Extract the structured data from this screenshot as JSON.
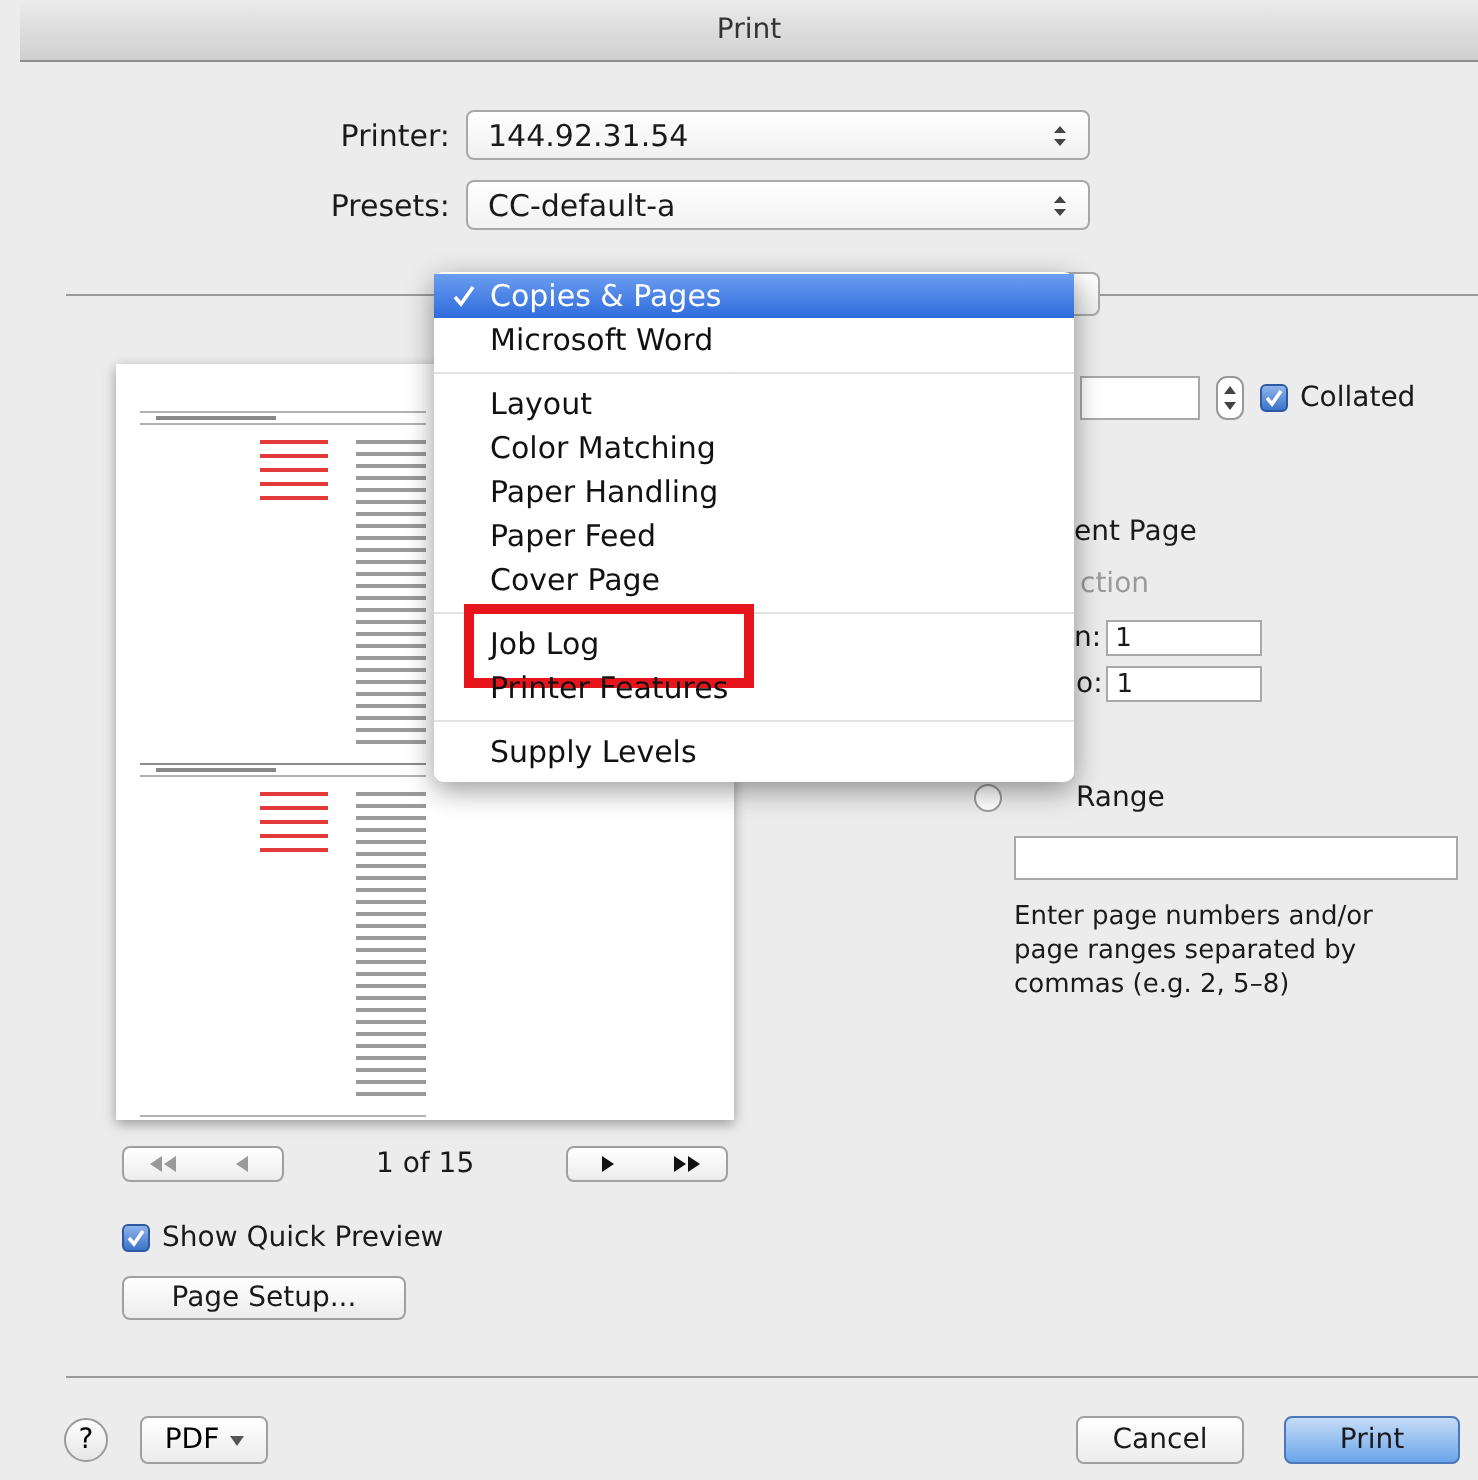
{
  "window": {
    "title": "Print"
  },
  "printer": {
    "label": "Printer:",
    "value": "144.92.31.54"
  },
  "presets": {
    "label": "Presets:",
    "value": "CC-default-a"
  },
  "panel_menu": {
    "groups": [
      [
        {
          "label": "Copies & Pages",
          "selected": true,
          "highlighted": false
        },
        {
          "label": "Microsoft Word",
          "selected": false,
          "highlighted": false
        }
      ],
      [
        {
          "label": "Layout",
          "selected": false,
          "highlighted": false
        },
        {
          "label": "Color Matching",
          "selected": false,
          "highlighted": false
        },
        {
          "label": "Paper Handling",
          "selected": false,
          "highlighted": false
        },
        {
          "label": "Paper Feed",
          "selected": false,
          "highlighted": false
        },
        {
          "label": "Cover Page",
          "selected": false,
          "highlighted": false
        }
      ],
      [
        {
          "label": "Job Log",
          "selected": false,
          "highlighted": true
        },
        {
          "label": "Printer Features",
          "selected": false,
          "highlighted": false
        }
      ],
      [
        {
          "label": "Supply Levels",
          "selected": false,
          "highlighted": false
        }
      ]
    ]
  },
  "copies": {
    "collated": {
      "label": "Collated",
      "checked": true
    }
  },
  "pages": {
    "current_page_label": "ent Page",
    "selection_label": "ction",
    "selection_disabled": true,
    "from": {
      "label": "n:",
      "value": "1"
    },
    "to": {
      "label": "o:",
      "value": "1"
    },
    "range": {
      "label": "Range",
      "selected": false
    },
    "hint": "Enter page numbers and/or page ranges separated by commas (e.g. 2, 5–8)"
  },
  "preview": {
    "page_indicator": "1 of 15"
  },
  "show_quick_preview": {
    "label": "Show Quick Preview",
    "checked": true
  },
  "page_setup": {
    "label": "Page Setup..."
  },
  "footer": {
    "help": "?",
    "pdf": "PDF",
    "cancel": "Cancel",
    "print": {
      "label": "Print",
      "default": true
    }
  }
}
